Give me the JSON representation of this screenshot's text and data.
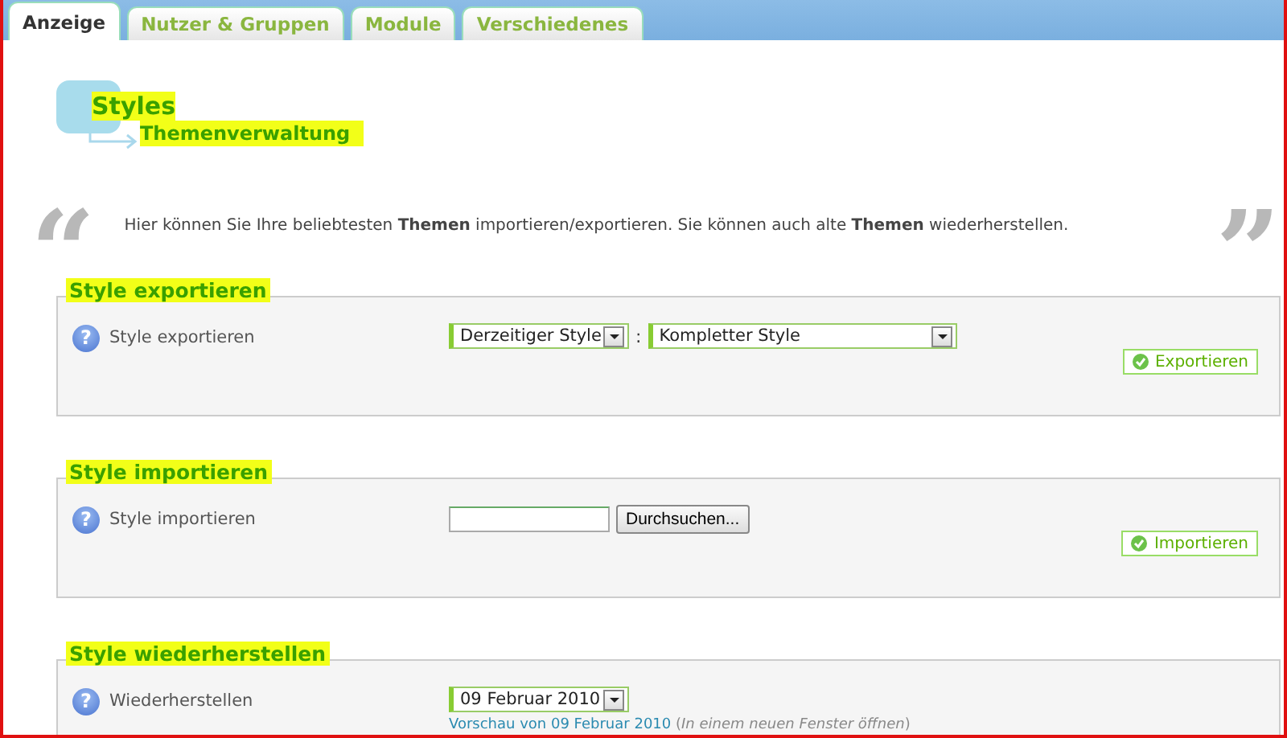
{
  "tabs": [
    {
      "label": "Anzeige",
      "selected": true
    },
    {
      "label": "Nutzer & Gruppen",
      "selected": false
    },
    {
      "label": "Module",
      "selected": false
    },
    {
      "label": "Verschiedenes",
      "selected": false
    }
  ],
  "breadcrumb": {
    "title": "Styles",
    "subtitle": "Themenverwaltung"
  },
  "intro": {
    "quote_open": "“",
    "text": "Hier können Sie Ihre beliebtesten **Themen** importieren/exportieren. Sie können auch alte **Themen** wiederherstellen.",
    "quote_close": "”"
  },
  "sections": [
    {
      "kind": "export",
      "help": "?",
      "title": "Style exportieren",
      "label": "Style exportieren",
      "selects": [
        "Derzeitiger Style",
        "Kompletter Style"
      ],
      "separator": ":",
      "button": "Exportieren"
    },
    {
      "kind": "import",
      "help": "?",
      "title": "Style importieren",
      "label": "Style importieren",
      "browse": "Durchsuchen...",
      "button": "Importieren"
    },
    {
      "kind": "restore",
      "help": "?",
      "title": "Style wiederherstellen",
      "label": "Wiederherstellen",
      "selects": [
        "09 Februar 2010"
      ],
      "link": "Vorschau von 09 Februar 2010",
      "note": "(*In einem neuen Fenster öffnen*)"
    }
  ]
}
